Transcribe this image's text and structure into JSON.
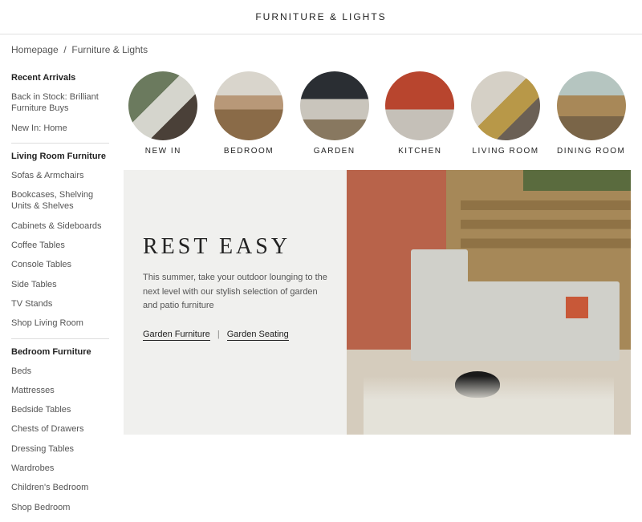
{
  "page_title": "FURNITURE & LIGHTS",
  "breadcrumb": {
    "home": "Homepage",
    "current": "Furniture & Lights"
  },
  "sidebar": {
    "sections": [
      {
        "heading": "Recent Arrivals",
        "items": [
          "Back in Stock: Brilliant Furniture Buys",
          "New In: Home"
        ]
      },
      {
        "heading": "Living Room Furniture",
        "items": [
          "Sofas & Armchairs",
          "Bookcases, Shelving Units & Shelves",
          "Cabinets & Sideboards",
          "Coffee Tables",
          "Console Tables",
          "Side Tables",
          "TV Stands",
          "Shop Living Room"
        ]
      },
      {
        "heading": "Bedroom Furniture",
        "items": [
          "Beds",
          "Mattresses",
          "Bedside Tables",
          "Chests of Drawers",
          "Dressing Tables",
          "Wardrobes",
          "Children's Bedroom",
          "Shop Bedroom"
        ]
      }
    ]
  },
  "circles": [
    {
      "label": "NEW IN"
    },
    {
      "label": "BEDROOM"
    },
    {
      "label": "GARDEN"
    },
    {
      "label": "KITCHEN"
    },
    {
      "label": "LIVING ROOM"
    },
    {
      "label": "DINING ROOM"
    }
  ],
  "hero": {
    "title": "REST EASY",
    "description": "This summer, take your outdoor lounging to the next level with our stylish selection of garden and patio furniture",
    "link1": "Garden Furniture",
    "link2": "Garden Seating",
    "separator": "|"
  }
}
